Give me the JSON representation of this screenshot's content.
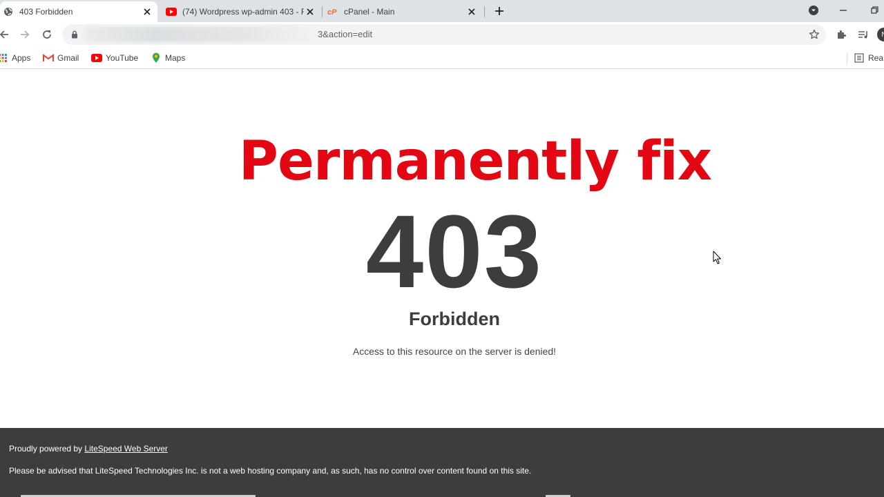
{
  "tabs": [
    {
      "title": "403 Forbidden",
      "favicon": "globe-icon"
    },
    {
      "title": "(74) Wordpress wp-admin 403 - F",
      "favicon": "youtube-icon"
    },
    {
      "title": "cPanel - Main",
      "favicon": "cpanel-icon"
    }
  ],
  "address_bar": {
    "url_visible": "3&action=edit"
  },
  "bookmarks": [
    {
      "label": "Apps",
      "icon": "apps-grid-icon"
    },
    {
      "label": "Gmail",
      "icon": "gmail-icon"
    },
    {
      "label": "YouTube",
      "icon": "youtube-icon"
    },
    {
      "label": "Maps",
      "icon": "maps-pin-icon"
    }
  ],
  "reading_list": {
    "label": "Rea"
  },
  "profile": {
    "initial": "N"
  },
  "page": {
    "overlay_title": "Permanently fix",
    "error_code": "403",
    "error_title": "Forbidden",
    "message": "Access to this resource on the server is denied!"
  },
  "footer": {
    "powered_prefix": "Proudly powered by",
    "powered_link": "LiteSpeed Web Server",
    "disclaimer": "Please be advised that LiteSpeed Technologies Inc. is not a web hosting company and, as such, has no control over content found on this site."
  },
  "colors": {
    "overlay_red": "#e30613",
    "error_text": "#3d3d3d",
    "footer_bg": "#3d3d3d",
    "tabstrip_bg": "#dee1e6",
    "omnibox_bg": "#f1f3f4"
  }
}
